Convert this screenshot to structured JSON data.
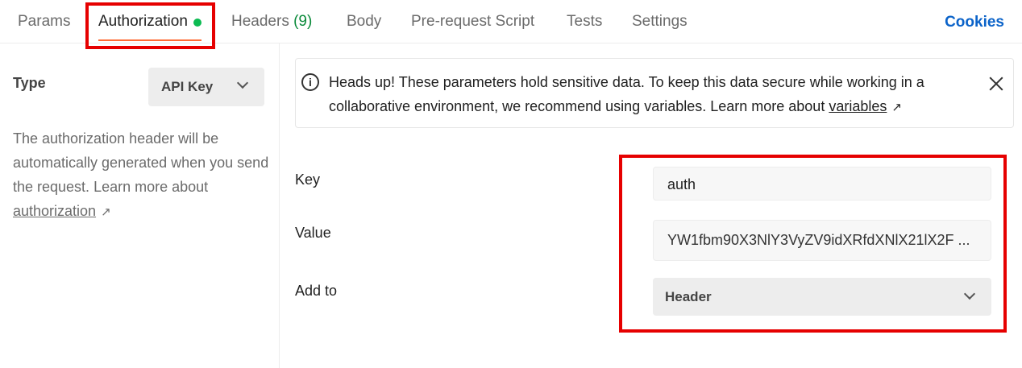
{
  "tabs": {
    "params": "Params",
    "authorization": "Authorization",
    "headers": "Headers",
    "headers_count": "(9)",
    "body": "Body",
    "prerequest": "Pre-request Script",
    "tests": "Tests",
    "settings": "Settings",
    "cookies": "Cookies",
    "active": "Authorization"
  },
  "left_panel": {
    "type_label": "Type",
    "type_value": "API Key",
    "description": "The authorization header will be automatically generated when you send the request. Learn more about",
    "link": "authorization",
    "link_arrow": "↗"
  },
  "notice": {
    "icon": "info-icon",
    "text": "Heads up! These parameters hold sensitive data. To keep this data secure while working in a collaborative environment, we recommend using variables. Learn more about",
    "link": "variables",
    "link_arrow": "↗"
  },
  "form": {
    "key_label": "Key",
    "key_value": "auth",
    "value_label": "Value",
    "value_value": "YW1fbm90X3NlY3VyZV9idXRfdXNlX21lX2F ...",
    "addto_label": "Add to",
    "addto_value": "Header"
  },
  "colors": {
    "accent": "#ff6c37",
    "status_dot": "#0cbb52",
    "cookies_link": "#0b63c9",
    "annotation": "#e60000"
  }
}
